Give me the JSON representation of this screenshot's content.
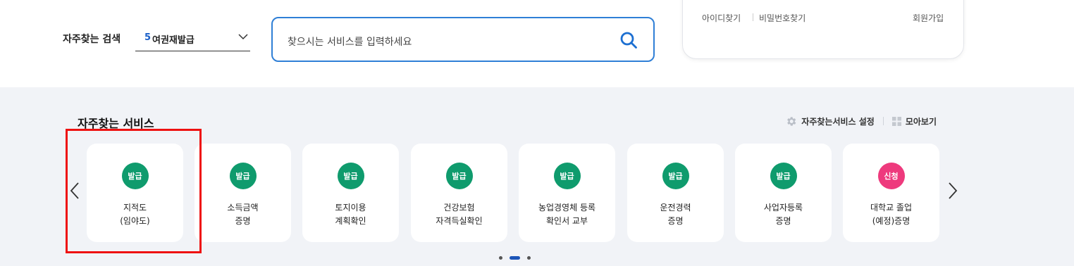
{
  "header": {
    "search_label": "자주찾는 검색",
    "rank_number": "5",
    "rank_text": "여권재발급",
    "search_placeholder": "찾으시는 서비스를 입력하세요"
  },
  "login_card": {
    "find_id": "아이디찾기",
    "find_password": "비밀번호찾기",
    "signup": "회원가입"
  },
  "services": {
    "title": "자주찾는 서비스",
    "settings_label": "자주찾는서비스 설정",
    "view_all_label": "모아보기",
    "items": [
      {
        "badge": "발급",
        "line1": "지적도",
        "line2": "(임야도)",
        "color": "#0f9b6d"
      },
      {
        "badge": "발급",
        "line1": "소득금액",
        "line2": "증명",
        "color": "#0f9b6d"
      },
      {
        "badge": "발급",
        "line1": "토지이용",
        "line2": "계획확인",
        "color": "#0f9b6d"
      },
      {
        "badge": "발급",
        "line1": "건강보험",
        "line2": "자격득실확인",
        "color": "#0f9b6d"
      },
      {
        "badge": "발급",
        "line1": "농업경영체 등록",
        "line2": "확인서 교부",
        "color": "#0f9b6d"
      },
      {
        "badge": "발급",
        "line1": "운전경력",
        "line2": "증명",
        "color": "#0f9b6d"
      },
      {
        "badge": "발급",
        "line1": "사업자등록",
        "line2": "증명",
        "color": "#0f9b6d"
      },
      {
        "badge": "신청",
        "line1": "대학교 졸업",
        "line2": "(예정)증명",
        "color": "#ee3a7d"
      }
    ],
    "pagination": {
      "total": 3,
      "active": 2
    }
  },
  "colors": {
    "accent": "#2f7fd6",
    "issue_badge": "#0f9b6d",
    "apply_badge": "#ee3a7d",
    "highlight": "#ee1111"
  }
}
